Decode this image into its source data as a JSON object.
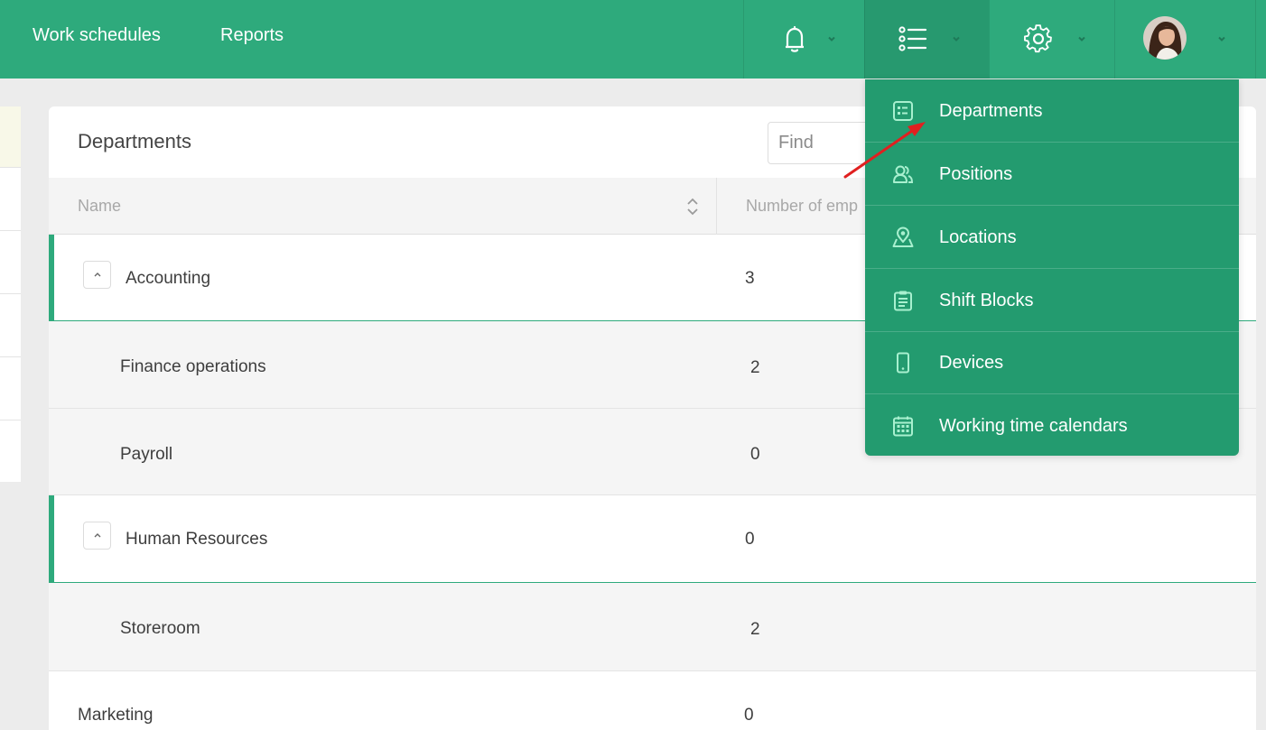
{
  "topnav": {
    "links": [
      "Work schedules",
      "Reports"
    ],
    "icons": [
      "bell-icon",
      "list-menu-icon",
      "gear-icon",
      "user-avatar"
    ]
  },
  "panel": {
    "title": "Departments",
    "search_placeholder": "Find",
    "columns": [
      "Name",
      "Number of emp"
    ],
    "rows": [
      {
        "name": "Accounting",
        "count": "3",
        "type": "parent",
        "expanded": true
      },
      {
        "name": "Finance operations",
        "count": "2",
        "type": "child"
      },
      {
        "name": "Payroll",
        "count": "0",
        "type": "child"
      },
      {
        "name": "Human Resources",
        "count": "0",
        "type": "parent",
        "expanded": true
      },
      {
        "name": "Storeroom",
        "count": "2",
        "type": "child"
      },
      {
        "name": "Marketing",
        "count": "0",
        "type": "plain"
      }
    ]
  },
  "dropdown": {
    "items": [
      {
        "label": "Departments",
        "icon": "departments-icon"
      },
      {
        "label": "Positions",
        "icon": "positions-icon"
      },
      {
        "label": "Locations",
        "icon": "location-icon"
      },
      {
        "label": "Shift Blocks",
        "icon": "clipboard-icon"
      },
      {
        "label": "Devices",
        "icon": "mobile-device-icon"
      },
      {
        "label": "Working time calendars",
        "icon": "calendar-icon"
      }
    ]
  },
  "colors": {
    "brand_green": "#2eaa7c",
    "dropdown_green": "#239b6f",
    "icon_tint": "#a8f0cf",
    "annotation_arrow": "#e02020"
  }
}
